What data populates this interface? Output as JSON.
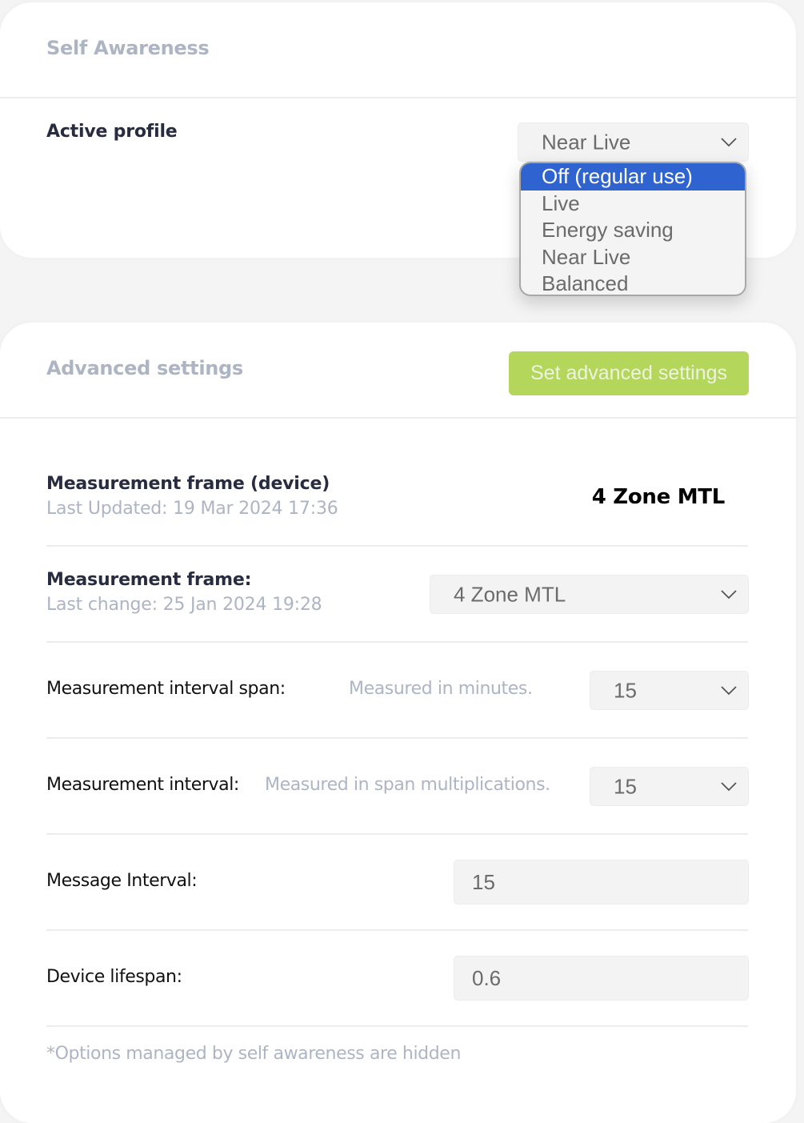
{
  "self_awareness": {
    "title": "Self Awareness",
    "active_profile_label": "Active profile",
    "active_profile_select": {
      "value": "Near Live",
      "icon": "chevron-down-icon",
      "options": [
        {
          "label": "Off (regular use)",
          "highlighted": true
        },
        {
          "label": "Live",
          "highlighted": false
        },
        {
          "label": "Energy saving",
          "highlighted": false
        },
        {
          "label": "Near Live",
          "highlighted": false
        },
        {
          "label": "Balanced",
          "highlighted": false
        }
      ]
    }
  },
  "advanced": {
    "title": "Advanced settings",
    "set_button_label": "Set advanced settings",
    "rows": {
      "device_frame": {
        "label": "Measurement frame (device)",
        "sub": "Last Updated: 19 Mar 2024 17:36",
        "value": "4 Zone MTL"
      },
      "measurement_frame": {
        "label": "Measurement frame:",
        "sub": "Last change: 25 Jan 2024 19:28",
        "value": "4 Zone MTL"
      },
      "interval_span": {
        "label": "Measurement interval span:",
        "hint": "Measured in minutes.",
        "value": "15"
      },
      "interval": {
        "label": "Measurement interval:",
        "hint": "Measured in span multiplications.",
        "value": "15"
      },
      "message_interval": {
        "label": "Message Interval:",
        "value": "15"
      },
      "device_lifespan": {
        "label": "Device lifespan:",
        "value": "0.6"
      }
    },
    "footnote": "*Options managed by self awareness are hidden"
  },
  "colors": {
    "accent_button": "#b4d65a",
    "selected_option": "#2f63cf",
    "muted_text": "#adb4c4",
    "heading_text": "#272c40"
  }
}
